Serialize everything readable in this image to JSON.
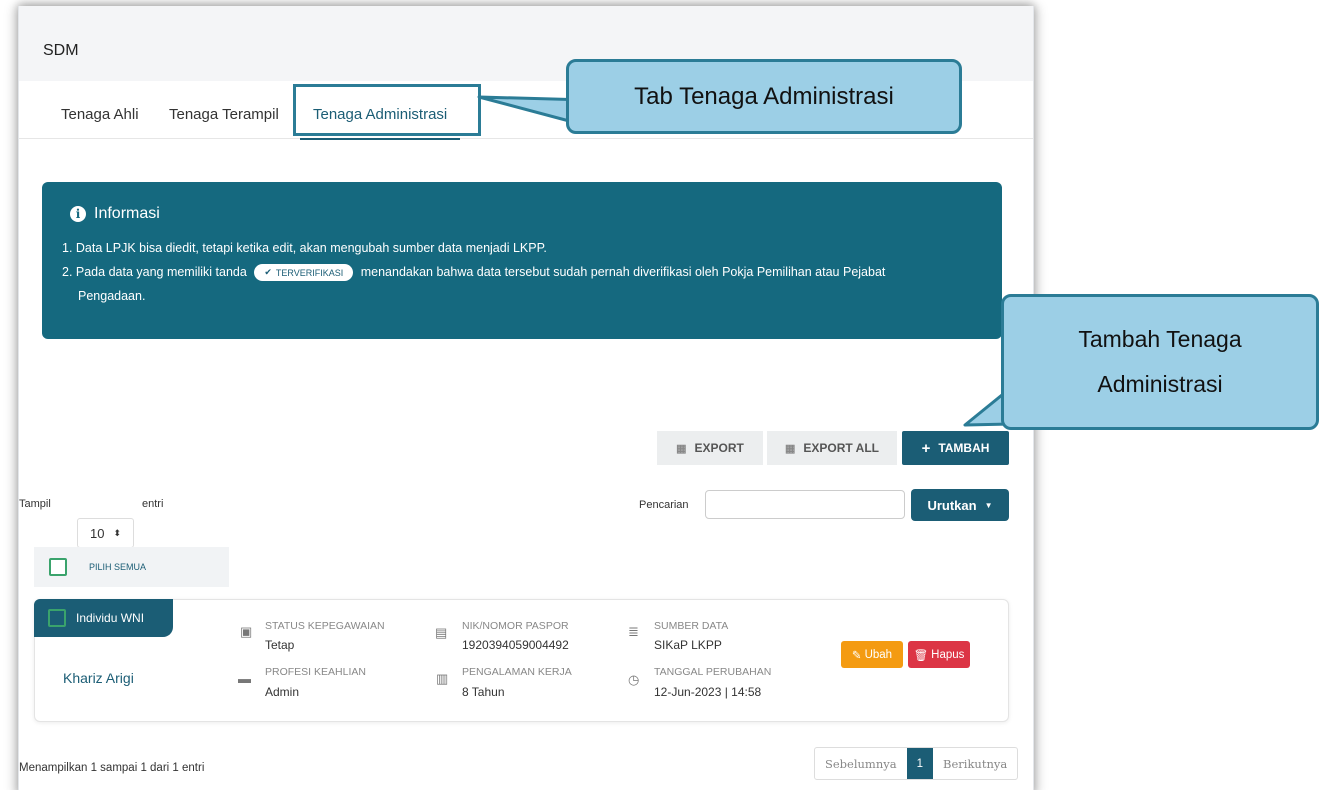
{
  "header": {
    "title": "SDM"
  },
  "tabs": [
    {
      "label": "Tenaga Ahli"
    },
    {
      "label": "Tenaga Terampil"
    },
    {
      "label": "Tenaga Administrasi"
    }
  ],
  "info": {
    "title": "Informasi",
    "line1": "1. Data LPJK bisa diedit, tetapi ketika edit, akan mengubah sumber data menjadi LKPP.",
    "line2_before": "2. Pada data yang memiliki tanda",
    "badge": "TERVERIFIKASI",
    "line2_after": "menandakan bahwa data tersebut sudah pernah diverifikasi oleh Pokja Pemilihan atau Pejabat",
    "line3": "Pengadaan."
  },
  "toolbar": {
    "export": "EXPORT",
    "export_all": "EXPORT ALL",
    "add": "TAMBAH"
  },
  "list": {
    "show_label": "Tampil",
    "show_value": "10",
    "entries_label": "entri",
    "search_label": "Pencarian",
    "search_value": "",
    "sort_label": "Urutkan",
    "select_all": "PILIH SEMUA"
  },
  "record": {
    "type": "Individu WNI",
    "name": "Khariz Arigi",
    "status_label": "STATUS KEPEGAWAIAN",
    "status_value": "Tetap",
    "profession_label": "PROFESI KEAHLIAN",
    "profession_value": "Admin",
    "nik_label": "NIK/NOMOR PASPOR",
    "nik_value": "1920394059004492",
    "experience_label": "PENGALAMAN KERJA",
    "experience_value": "8 Tahun",
    "source_label": "SUMBER DATA",
    "source_value": "SIKaP LKPP",
    "changed_label": "TANGGAL PERUBAHAN",
    "changed_value": "12-Jun-2023 | 14:58",
    "edit": "Ubah",
    "delete": "Hapus"
  },
  "footer": {
    "summary": "Menampilkan 1 sampai 1 dari 1 entri",
    "prev": "Sebelumnya",
    "page": "1",
    "next": "Berikutnya"
  },
  "callouts": {
    "tab": "Tab Tenaga Administrasi",
    "add_line1": "Tambah Tenaga",
    "add_line2": "Administrasi"
  },
  "colors": {
    "primary": "#1b5d75",
    "info_bg": "#15697f",
    "callout_bg": "#9ccfe6",
    "callout_border": "#2b7c96",
    "edit": "#f49b12",
    "delete": "#dc3545"
  }
}
